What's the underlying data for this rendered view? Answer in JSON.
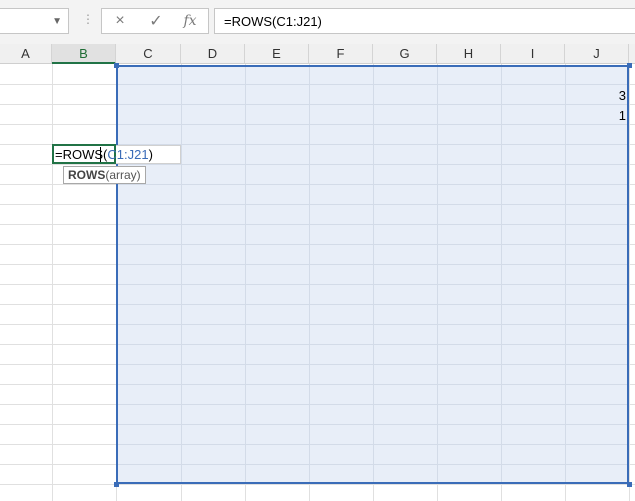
{
  "formula_bar": {
    "name_box": "",
    "dots": "⋮",
    "cancel_icon": "×",
    "enter_icon": "✓",
    "fx_label": "fx",
    "formula": "=ROWS(C1:J21)"
  },
  "columns": [
    "A",
    "B",
    "C",
    "D",
    "E",
    "F",
    "G",
    "H",
    "I",
    "J"
  ],
  "active_column": "B",
  "cells": {
    "J4": "3",
    "J5": "1"
  },
  "edit_cell": {
    "prefix": "=ROWS(",
    "ref": "C1:J21",
    "suffix": ")"
  },
  "tooltip": {
    "function": "ROWS",
    "args": "(array)"
  },
  "selected_range": "C1:J21",
  "colors": {
    "range_border": "#3a6cb8",
    "range_fill": "#e8eef8",
    "active_cell_border": "#217346"
  }
}
